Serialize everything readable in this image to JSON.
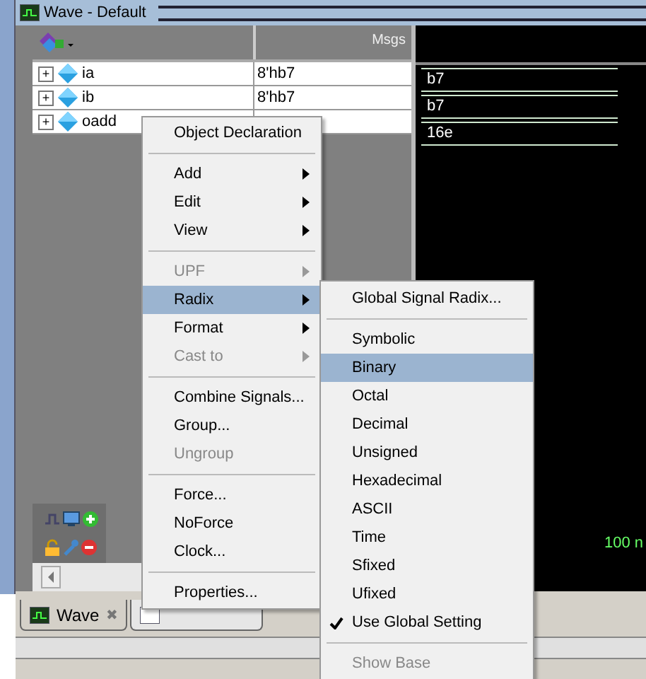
{
  "window": {
    "title": "Wave - Default"
  },
  "columns": {
    "msgs": "Msgs"
  },
  "signals": [
    {
      "expand": "+",
      "name": "ia",
      "value": "8'hb7",
      "wave_value": "b7"
    },
    {
      "expand": "+",
      "name": "ib",
      "value": "8'hb7",
      "wave_value": "b7"
    },
    {
      "expand": "+",
      "name": "oadd",
      "wave_value": "16e"
    }
  ],
  "timeline": {
    "label": "100 n"
  },
  "tabs": [
    {
      "label": "Wave",
      "selected": true,
      "close": "✖"
    },
    {
      "selected": false
    }
  ],
  "context_menu": [
    {
      "kind": "item",
      "label": "Object Declaration",
      "disabled": false,
      "submenu": false,
      "selected": false
    },
    {
      "kind": "separator"
    },
    {
      "kind": "item",
      "label": "Add",
      "disabled": false,
      "submenu": true,
      "selected": false
    },
    {
      "kind": "item",
      "label": "Edit",
      "disabled": false,
      "submenu": true,
      "selected": false
    },
    {
      "kind": "item",
      "label": "View",
      "disabled": false,
      "submenu": true,
      "selected": false
    },
    {
      "kind": "separator"
    },
    {
      "kind": "item",
      "label": "UPF",
      "disabled": true,
      "submenu": true,
      "selected": false
    },
    {
      "kind": "item",
      "label": "Radix",
      "disabled": false,
      "submenu": true,
      "selected": true
    },
    {
      "kind": "item",
      "label": "Format",
      "disabled": false,
      "submenu": true,
      "selected": false
    },
    {
      "kind": "item",
      "label": "Cast to",
      "disabled": true,
      "submenu": true,
      "selected": false
    },
    {
      "kind": "separator"
    },
    {
      "kind": "item",
      "label": "Combine Signals...",
      "disabled": false,
      "submenu": false,
      "selected": false
    },
    {
      "kind": "item",
      "label": "Group...",
      "disabled": false,
      "submenu": false,
      "selected": false
    },
    {
      "kind": "item",
      "label": "Ungroup",
      "disabled": true,
      "submenu": false,
      "selected": false
    },
    {
      "kind": "separator"
    },
    {
      "kind": "item",
      "label": "Force...",
      "disabled": false,
      "submenu": false,
      "selected": false
    },
    {
      "kind": "item",
      "label": "NoForce",
      "disabled": false,
      "submenu": false,
      "selected": false
    },
    {
      "kind": "item",
      "label": "Clock...",
      "disabled": false,
      "submenu": false,
      "selected": false
    },
    {
      "kind": "separator"
    },
    {
      "kind": "item",
      "label": "Properties...",
      "disabled": false,
      "submenu": false,
      "selected": false
    }
  ],
  "radix_menu": [
    {
      "kind": "item",
      "label": "Global Signal Radix...",
      "disabled": false,
      "checked": false,
      "selected": false
    },
    {
      "kind": "separator"
    },
    {
      "kind": "item",
      "label": "Symbolic",
      "disabled": false,
      "checked": false,
      "selected": false
    },
    {
      "kind": "item",
      "label": "Binary",
      "disabled": false,
      "checked": false,
      "selected": true
    },
    {
      "kind": "item",
      "label": "Octal",
      "disabled": false,
      "checked": false,
      "selected": false
    },
    {
      "kind": "item",
      "label": "Decimal",
      "disabled": false,
      "checked": false,
      "selected": false
    },
    {
      "kind": "item",
      "label": "Unsigned",
      "disabled": false,
      "checked": false,
      "selected": false
    },
    {
      "kind": "item",
      "label": "Hexadecimal",
      "disabled": false,
      "checked": false,
      "selected": false
    },
    {
      "kind": "item",
      "label": "ASCII",
      "disabled": false,
      "checked": false,
      "selected": false
    },
    {
      "kind": "item",
      "label": "Time",
      "disabled": false,
      "checked": false,
      "selected": false
    },
    {
      "kind": "item",
      "label": "Sfixed",
      "disabled": false,
      "checked": false,
      "selected": false
    },
    {
      "kind": "item",
      "label": "Ufixed",
      "disabled": false,
      "checked": false,
      "selected": false
    },
    {
      "kind": "item",
      "label": "Use Global Setting",
      "disabled": false,
      "checked": true,
      "selected": false
    },
    {
      "kind": "separator"
    },
    {
      "kind": "item",
      "label": "Show Base",
      "disabled": true,
      "checked": false,
      "selected": false
    }
  ]
}
